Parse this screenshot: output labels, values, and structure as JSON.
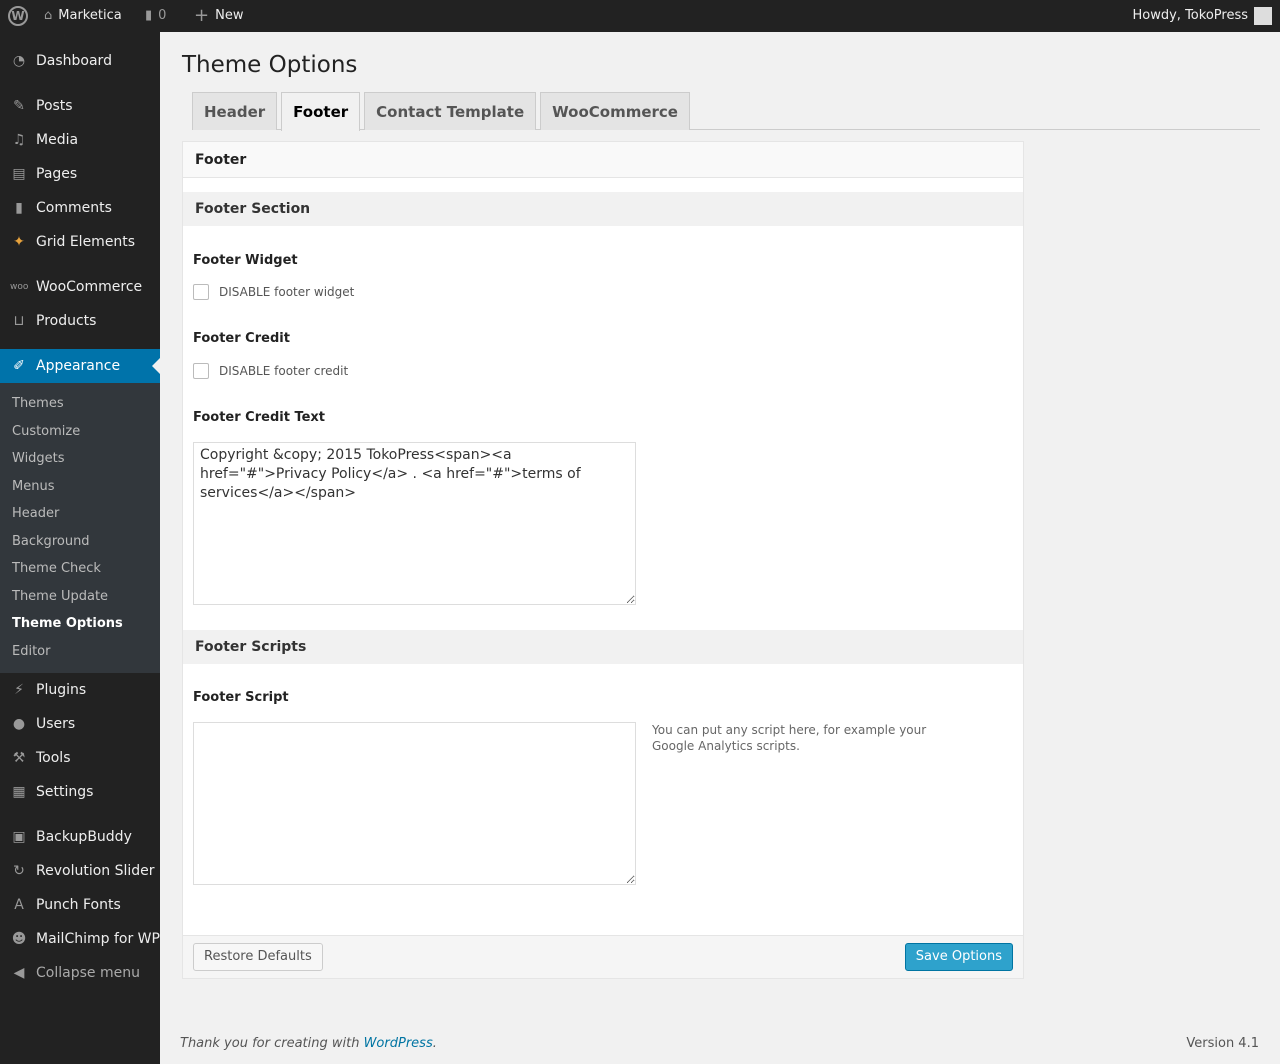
{
  "adminbar": {
    "site": "Marketica",
    "comments": "0",
    "new": "New",
    "howdy": "Howdy, TokoPress"
  },
  "sidebar": {
    "items": [
      "Dashboard",
      "Posts",
      "Media",
      "Pages",
      "Comments",
      "Grid Elements",
      "WooCommerce",
      "Products",
      "Appearance",
      "Plugins",
      "Users",
      "Tools",
      "Settings",
      "BackupBuddy",
      "Revolution Slider",
      "Punch Fonts",
      "MailChimp for WP",
      "Collapse menu"
    ],
    "submenu": [
      "Themes",
      "Customize",
      "Widgets",
      "Menus",
      "Header",
      "Background",
      "Theme Check",
      "Theme Update",
      "Theme Options",
      "Editor"
    ]
  },
  "page": {
    "title": "Theme Options",
    "tabs": [
      "Header",
      "Footer",
      "Contact Template",
      "WooCommerce"
    ],
    "active_tab": "Footer"
  },
  "panel": {
    "title": "Footer",
    "section1": "Footer Section",
    "footer_widget": "Footer Widget",
    "disable_widget": "DISABLE footer widget",
    "footer_credit": "Footer Credit",
    "disable_credit": "DISABLE footer credit",
    "credit_text_label": "Footer Credit Text",
    "credit_text": "Copyright &copy; 2015 TokoPress<span><a href=\"#\">Privacy Policy</a> . <a href=\"#\">terms of services</a></span>",
    "section2": "Footer Scripts",
    "script_label": "Footer Script",
    "script_value": "",
    "script_desc": "You can put any script here, for example your Google Analytics scripts.",
    "restore": "Restore Defaults",
    "save": "Save Options"
  },
  "footer": {
    "thanks": "Thank you for creating with ",
    "wp": "WordPress",
    "dot": ".",
    "version": "Version 4.1"
  },
  "colors": {
    "accent": "#0073aa",
    "primary_button": "#2ea2cc"
  }
}
